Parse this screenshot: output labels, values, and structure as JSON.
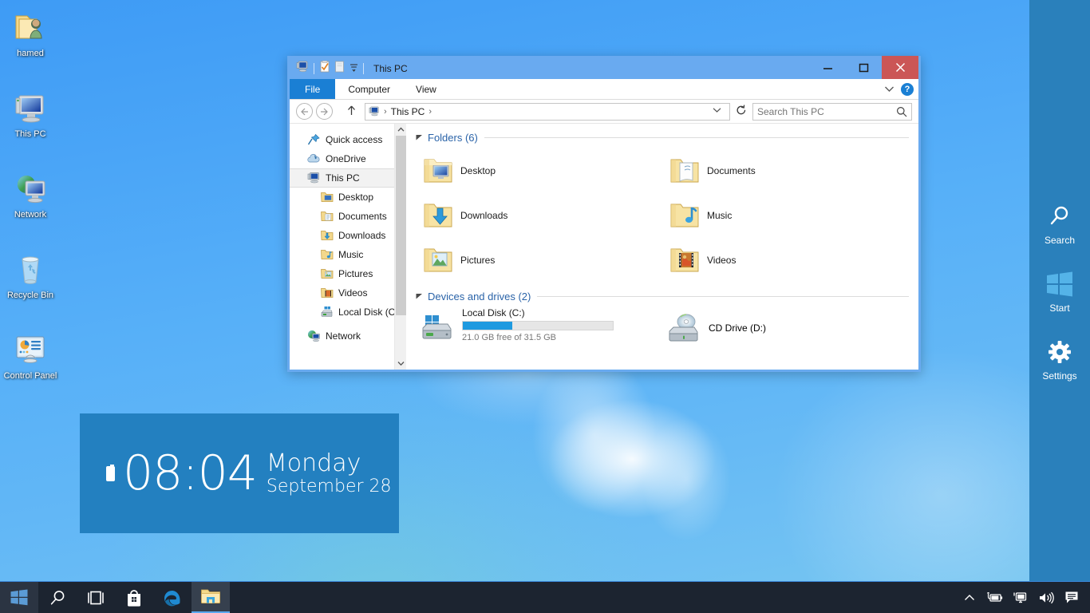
{
  "desktop": {
    "icons": [
      {
        "label": "hamed",
        "icon": "user-folder-icon"
      },
      {
        "label": "This PC",
        "icon": "computer-icon"
      },
      {
        "label": "Network",
        "icon": "network-icon"
      },
      {
        "label": "Recycle Bin",
        "icon": "recycle-bin-icon"
      },
      {
        "label": "Control Panel",
        "icon": "control-panel-icon"
      }
    ],
    "wallpaper_colors": {
      "top": "#3e9bf5",
      "bottom": "#79c8f0"
    }
  },
  "clock_widget": {
    "time": "08:04",
    "day": "Monday",
    "month_day": "September 28",
    "background": "#2380c0",
    "battery_icon": "battery-icon"
  },
  "charms": {
    "background": "#2a80bb",
    "items": [
      {
        "label": "Search",
        "icon": "search-icon"
      },
      {
        "label": "Start",
        "icon": "windows-start-icon"
      },
      {
        "label": "Settings",
        "icon": "gear-icon"
      }
    ]
  },
  "explorer": {
    "frame_color": "#69aaf0",
    "title": "This PC",
    "quick_access_toolbar": [
      {
        "name": "this-pc-icon"
      },
      {
        "name": "properties-icon"
      },
      {
        "name": "new-folder-icon"
      },
      {
        "name": "customize-dropdown-icon"
      }
    ],
    "window_buttons": {
      "minimize": "–",
      "maximize": "☐",
      "close": "×",
      "close_color": "#cb5656"
    },
    "ribbon": {
      "tabs": [
        {
          "label": "File",
          "active": true
        },
        {
          "label": "Computer",
          "active": false
        },
        {
          "label": "View",
          "active": false
        }
      ],
      "collapse_icon": "chevron-down-icon",
      "help_label": "?"
    },
    "addressbar": {
      "back_icon": "←",
      "forward_icon": "→",
      "up_icon": "↑",
      "breadcrumb_icon": "this-pc-icon",
      "breadcrumb": "This PC",
      "sep": "›",
      "dropdown_icon": "∨",
      "refresh_icon": "↻"
    },
    "search": {
      "placeholder": "Search This PC",
      "value": "",
      "icon": "search-icon"
    },
    "navpane": {
      "items": [
        {
          "label": "Quick access",
          "icon": "pin-star-icon",
          "child": false,
          "selected": false
        },
        {
          "label": "OneDrive",
          "icon": "onedrive-icon",
          "child": false,
          "selected": false
        },
        {
          "label": "This PC",
          "icon": "computer-icon",
          "child": false,
          "selected": true
        },
        {
          "label": "Desktop",
          "icon": "desktop-folder-icon",
          "child": true,
          "selected": false
        },
        {
          "label": "Documents",
          "icon": "documents-folder-icon",
          "child": true,
          "selected": false
        },
        {
          "label": "Downloads",
          "icon": "downloads-folder-icon",
          "child": true,
          "selected": false
        },
        {
          "label": "Music",
          "icon": "music-folder-icon",
          "child": true,
          "selected": false
        },
        {
          "label": "Pictures",
          "icon": "pictures-folder-icon",
          "child": true,
          "selected": false
        },
        {
          "label": "Videos",
          "icon": "videos-folder-icon",
          "child": true,
          "selected": false
        },
        {
          "label": "Local Disk (C:)",
          "icon": "hard-drive-icon",
          "child": true,
          "selected": false
        },
        {
          "label": "Network",
          "icon": "network-icon",
          "child": false,
          "selected": false
        }
      ],
      "scroll_up_icon": "⌃",
      "scroll_down_icon": "⌄"
    },
    "content": {
      "folders_group": {
        "title": "Folders (6)",
        "collapse_icon": "◢",
        "items": [
          {
            "label": "Desktop",
            "icon": "desktop-folder-icon"
          },
          {
            "label": "Documents",
            "icon": "documents-folder-icon"
          },
          {
            "label": "Downloads",
            "icon": "downloads-folder-icon"
          },
          {
            "label": "Music",
            "icon": "music-folder-icon"
          },
          {
            "label": "Pictures",
            "icon": "pictures-folder-icon"
          },
          {
            "label": "Videos",
            "icon": "videos-folder-icon"
          }
        ]
      },
      "devices_group": {
        "title": "Devices and drives (2)",
        "collapse_icon": "◢",
        "drives": [
          {
            "name": "Local Disk (C:)",
            "icon": "windows-drive-icon",
            "free_text": "21.0 GB free of 31.5 GB",
            "used_percent": 33,
            "bar_color": "#1e9ae0",
            "has_bar": true
          },
          {
            "name": "CD Drive (D:)",
            "icon": "cd-drive-icon",
            "free_text": "",
            "used_percent": 0,
            "has_bar": false
          }
        ]
      }
    }
  },
  "taskbar": {
    "background": "#1c2430",
    "start": {
      "icon": "windows-start-icon",
      "label": "Start"
    },
    "buttons": [
      {
        "icon": "search-icon",
        "label": "Search",
        "active": false
      },
      {
        "icon": "task-view-icon",
        "label": "Task View",
        "active": false
      },
      {
        "icon": "store-icon",
        "label": "Store",
        "active": false
      },
      {
        "icon": "edge-icon",
        "label": "Microsoft Edge",
        "active": false
      },
      {
        "icon": "file-explorer-icon",
        "label": "File Explorer",
        "active": true
      }
    ],
    "tray": [
      {
        "icon": "show-hidden-icons-chevron-icon",
        "label": "Show hidden icons"
      },
      {
        "icon": "battery-plug-icon",
        "label": "Battery"
      },
      {
        "icon": "network-monitor-icon",
        "label": "Network"
      },
      {
        "icon": "volume-icon",
        "label": "Volume"
      },
      {
        "icon": "action-center-icon",
        "label": "Action Center"
      }
    ]
  }
}
